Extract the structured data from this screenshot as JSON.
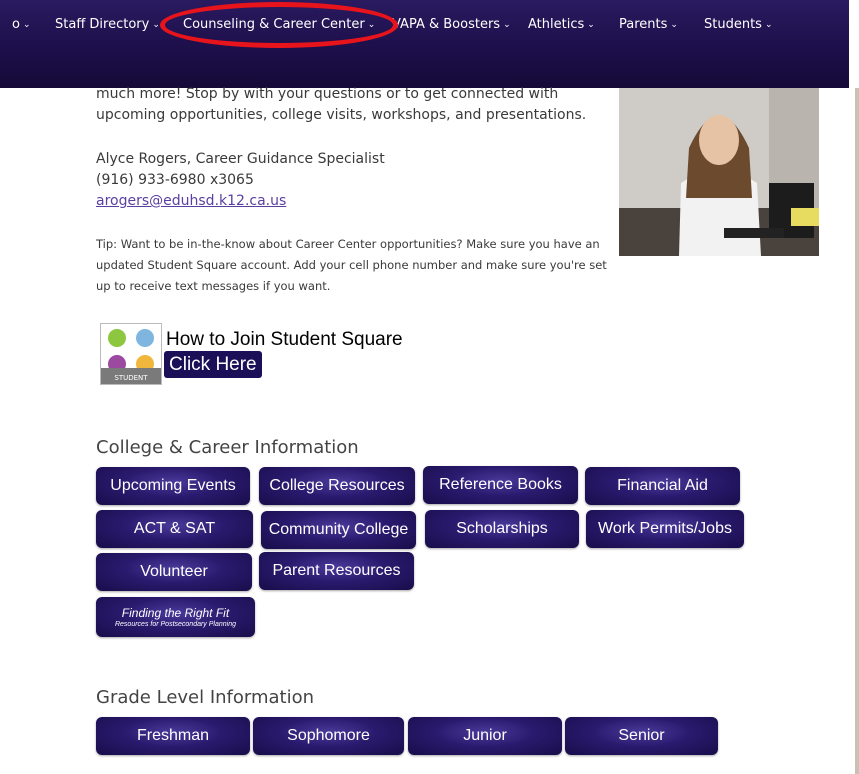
{
  "nav": {
    "prev": "o",
    "staff": "Staff Directory",
    "counsel": "Counseling & Career Center",
    "vapa": "VAPA & Boosters",
    "athletics": "Athletics",
    "parents": "Parents",
    "students": "Students"
  },
  "intro": "much more! Stop by with your questions or to get connected with upcoming opportunities, college visits, workshops, and presentations.",
  "contact": {
    "name": "Alyce Rogers, Career Guidance Specialist",
    "phone": "(916) 933-6980 x3065",
    "email": "arogers@eduhsd.k12.ca.us"
  },
  "tip": "Tip: Want to be in-the-know about Career Center opportunities? Make sure you have an updated Student Square account. Add your cell phone number and make sure you're set up to receive text messages if you want.",
  "student_square": {
    "logo_text": "STUDENT",
    "heading": "How to Join Student Square",
    "cta": "Click Here"
  },
  "college": {
    "title": "College & Career Information",
    "upcoming": "Upcoming Events",
    "resources": "College Resources",
    "reference": "Reference Books",
    "financial": "Financial Aid",
    "actsat": "ACT & SAT",
    "community": "Community College",
    "scholarships": "Scholarships",
    "work": "Work Permits/Jobs",
    "volunteer": "Volunteer",
    "parent_res": "Parent Resources",
    "fit_title": "Finding the Right Fit",
    "fit_sub": "Resources for Postsecondary Planning"
  },
  "grade": {
    "title": "Grade Level Information",
    "freshman": "Freshman",
    "sophomore": "Sophomore",
    "junior": "Junior",
    "senior": "Senior"
  },
  "colors": {
    "nav_bg": "#1d0f4a",
    "button_bg": "#2a1a6e",
    "highlight": "#e8141c",
    "link": "#5b3fa0"
  }
}
